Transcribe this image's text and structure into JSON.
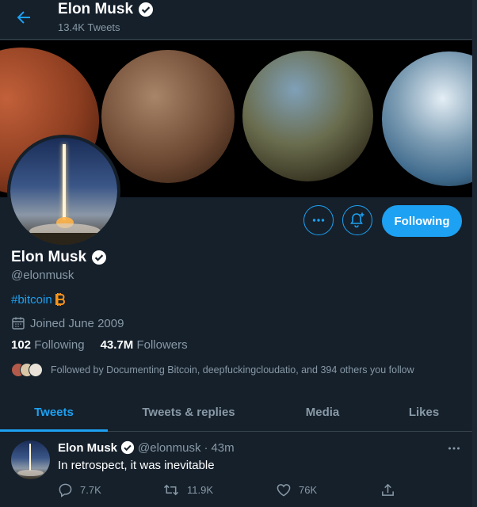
{
  "header": {
    "title": "Elon Musk",
    "tweet_count": "13.4K Tweets"
  },
  "profile": {
    "name": "Elon Musk",
    "handle": "@elonmusk",
    "bio": "#bitcoin",
    "joined": "Joined June 2009",
    "following_count": "102",
    "following_label": "Following",
    "followers_count": "43.7M",
    "followers_label": "Followers",
    "followed_by": "Followed by Documenting Bitcoin, deepfuckingcloudatio, and 394 others you follow",
    "follow_button": "Following"
  },
  "tabs": [
    {
      "label": "Tweets",
      "active": true
    },
    {
      "label": "Tweets & replies",
      "active": false
    },
    {
      "label": "Media",
      "active": false
    },
    {
      "label": "Likes",
      "active": false
    }
  ],
  "tweet": {
    "name": "Elon Musk",
    "handle": "@elonmusk",
    "separator": "·",
    "time": "43m",
    "text": "In retrospect, it was inevitable",
    "replies": "7.7K",
    "retweets": "11.9K",
    "likes": "76K"
  },
  "colors": {
    "background": "#15202b",
    "accent": "#1da1f2",
    "muted": "#8899a6",
    "border": "#38444d"
  },
  "icons": [
    "back-arrow-icon",
    "verified-badge-icon",
    "more-icon",
    "notification-bell-icon",
    "bitcoin-icon",
    "calendar-icon",
    "reply-icon",
    "retweet-icon",
    "like-icon",
    "share-icon"
  ]
}
